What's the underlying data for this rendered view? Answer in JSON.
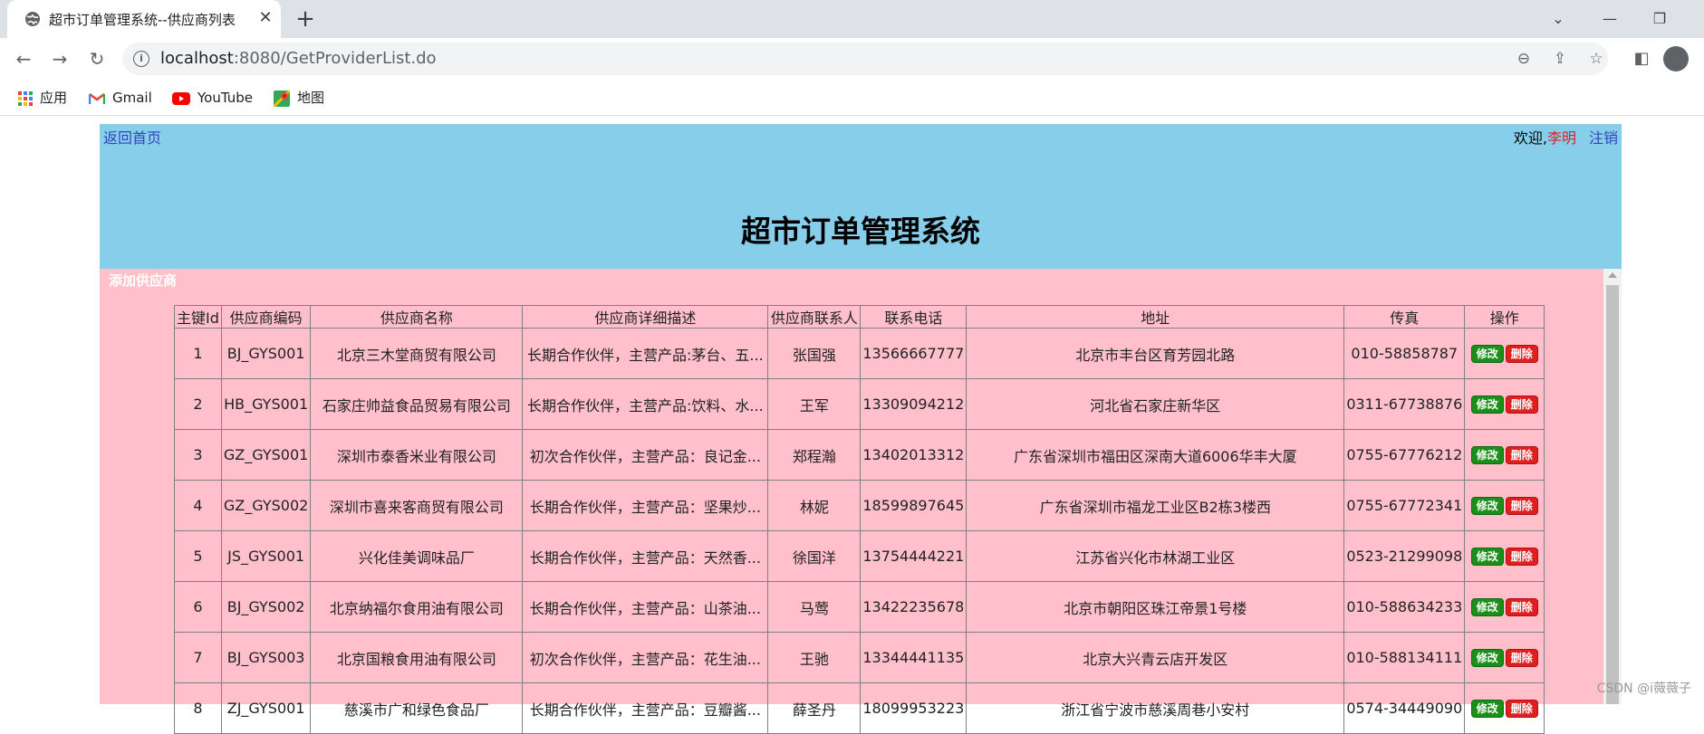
{
  "browser": {
    "tab_title": "超市订单管理系统--供应商列表",
    "url_host": "localhost",
    "url_path": ":8080/GetProviderList.do",
    "bookmarks": [
      {
        "label": "应用",
        "icon": "apps-grid-icon"
      },
      {
        "label": "Gmail",
        "icon": "gmail-icon"
      },
      {
        "label": "YouTube",
        "icon": "youtube-icon"
      },
      {
        "label": "地图",
        "icon": "maps-icon"
      }
    ]
  },
  "header": {
    "back_link": "返回首页",
    "welcome_prefix": "欢迎,",
    "username": "李明",
    "logout": "注销",
    "site_title": "超市订单管理系统"
  },
  "content": {
    "add_link": "添加供应商",
    "columns": [
      "主键Id",
      "供应商编码",
      "供应商名称",
      "供应商详细描述",
      "供应商联系人",
      "联系电话",
      "地址",
      "传真",
      "操作"
    ],
    "edit_label": "修改",
    "delete_label": "删除",
    "rows": [
      {
        "id": "1",
        "code": "BJ_GYS001",
        "name": "北京三木堂商贸有限公司",
        "desc": "长期合作伙伴，主营产品:茅台、五...",
        "contact": "张国强",
        "phone": "13566667777",
        "address": "北京市丰台区育芳园北路",
        "fax": "010-58858787"
      },
      {
        "id": "2",
        "code": "HB_GYS001",
        "name": "石家庄帅益食品贸易有限公司",
        "desc": "长期合作伙伴，主营产品:饮料、水...",
        "contact": "王军",
        "phone": "13309094212",
        "address": "河北省石家庄新华区",
        "fax": "0311-67738876"
      },
      {
        "id": "3",
        "code": "GZ_GYS001",
        "name": "深圳市泰香米业有限公司",
        "desc": "初次合作伙伴，主营产品：良记金...",
        "contact": "郑程瀚",
        "phone": "13402013312",
        "address": "广东省深圳市福田区深南大道6006华丰大厦",
        "fax": "0755-67776212"
      },
      {
        "id": "4",
        "code": "GZ_GYS002",
        "name": "深圳市喜来客商贸有限公司",
        "desc": "长期合作伙伴，主营产品：坚果炒...",
        "contact": "林妮",
        "phone": "18599897645",
        "address": "广东省深圳市福龙工业区B2栋3楼西",
        "fax": "0755-67772341"
      },
      {
        "id": "5",
        "code": "JS_GYS001",
        "name": "兴化佳美调味品厂",
        "desc": "长期合作伙伴，主营产品：天然香...",
        "contact": "徐国洋",
        "phone": "13754444221",
        "address": "江苏省兴化市林湖工业区",
        "fax": "0523-21299098"
      },
      {
        "id": "6",
        "code": "BJ_GYS002",
        "name": "北京纳福尔食用油有限公司",
        "desc": "长期合作伙伴，主营产品：山茶油...",
        "contact": "马莺",
        "phone": "13422235678",
        "address": "北京市朝阳区珠江帝景1号楼",
        "fax": "010-588634233"
      },
      {
        "id": "7",
        "code": "BJ_GYS003",
        "name": "北京国粮食用油有限公司",
        "desc": "初次合作伙伴，主营产品：花生油...",
        "contact": "王驰",
        "phone": "13344441135",
        "address": "北京大兴青云店开发区",
        "fax": "010-588134111"
      },
      {
        "id": "8",
        "code": "ZJ_GYS001",
        "name": "慈溪市广和绿色食品厂",
        "desc": "长期合作伙伴，主营产品：豆瓣酱...",
        "contact": "薛圣丹",
        "phone": "18099953223",
        "address": "浙江省宁波市慈溪周巷小安村",
        "fax": "0574-34449090"
      }
    ]
  },
  "watermark": "CSDN @i薇薇子"
}
